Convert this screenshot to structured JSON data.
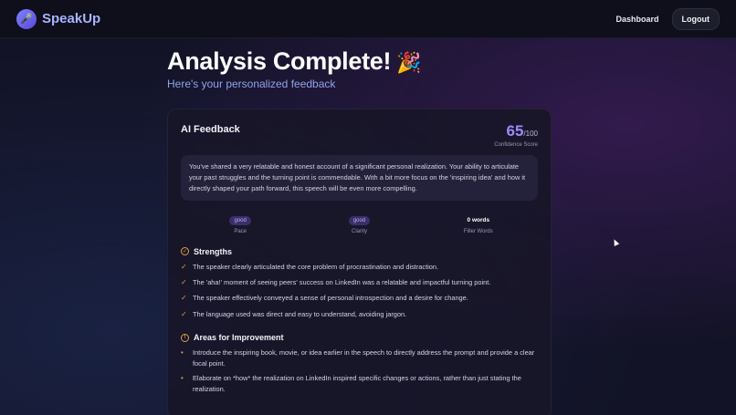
{
  "brand": {
    "name": "SpeakUp",
    "logo_icon": "microphone-icon"
  },
  "nav": {
    "dashboard": "Dashboard",
    "logout": "Logout"
  },
  "heading": {
    "title": "Analysis Complete!",
    "emoji": "🎉",
    "subtitle": "Here's your personalized feedback"
  },
  "feedback": {
    "title": "AI Feedback",
    "score_value": "65",
    "score_max": "/100",
    "score_label": "Confidence Score",
    "summary": "You've shared a very relatable and honest account of a significant personal realization. Your ability to articulate your past struggles and the turning point is commendable. With a bit more focus on the 'inspiring idea' and how it directly shaped your path forward, this speech will be even more compelling."
  },
  "metrics": [
    {
      "value": "good",
      "label": "Pace"
    },
    {
      "value": "good",
      "label": "Clarity"
    },
    {
      "value": "0 words",
      "label": "Filler Words"
    }
  ],
  "strengths": {
    "title": "Strengths",
    "items": [
      "The speaker clearly articulated the core problem of procrastination and distraction.",
      "The 'aha!' moment of seeing peers' success on LinkedIn was a relatable and impactful turning point.",
      "The speaker effectively conveyed a sense of personal introspection and a desire for change.",
      "The language used was direct and easy to understand, avoiding jargon."
    ]
  },
  "improvements": {
    "title": "Areas for Improvement",
    "items": [
      "Introduce the inspiring book, movie, or idea earlier in the speech to directly address the prompt and provide a clear focal point.",
      "Elaborate on *how* the realization on LinkedIn inspired specific changes or actions, rather than just stating the realization."
    ]
  },
  "colors": {
    "accent": "#9a8cff",
    "brand": "#a8b4ff",
    "highlight": "#e0a040",
    "background": "#121326"
  }
}
